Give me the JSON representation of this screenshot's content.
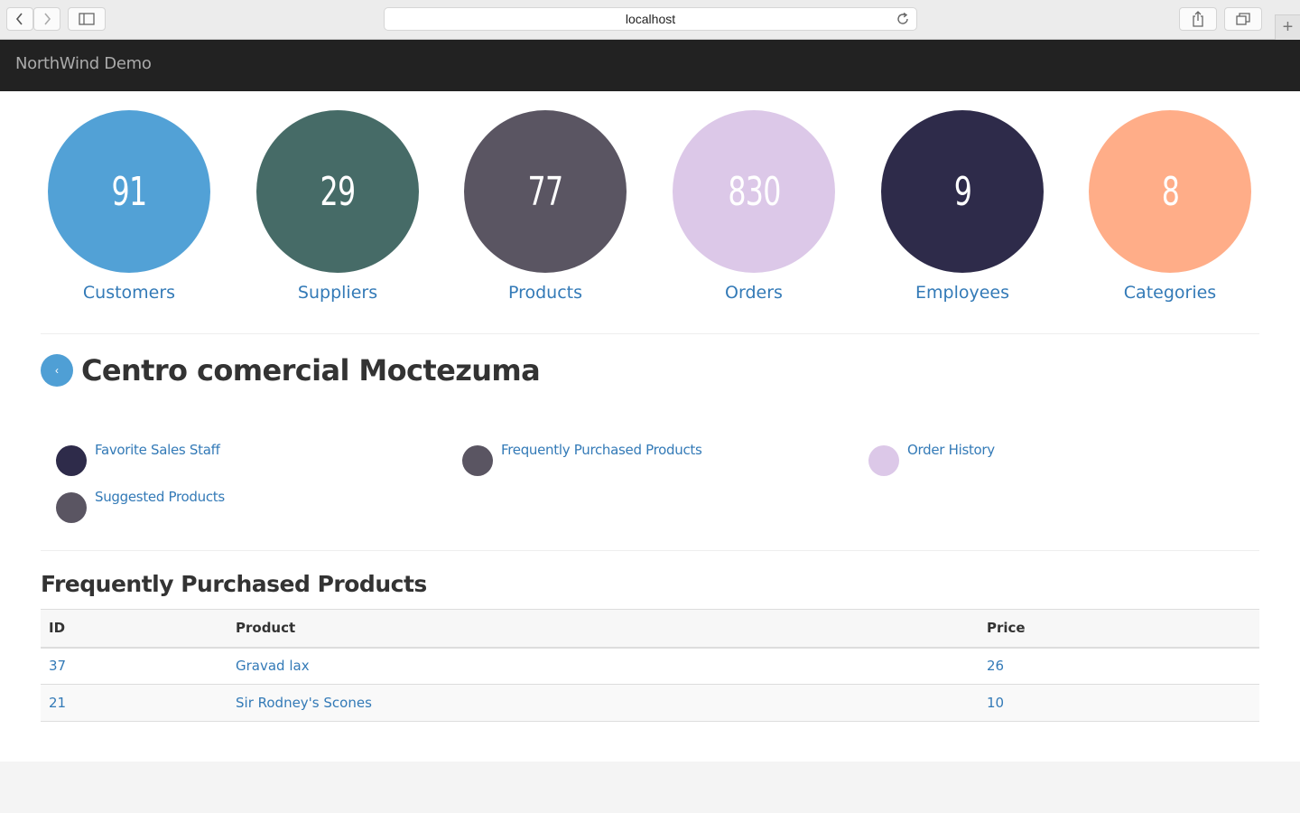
{
  "browser": {
    "address": "localhost",
    "new_tab_symbol": "+"
  },
  "navbar": {
    "brand": "NorthWind Demo"
  },
  "stats": [
    {
      "count": "91",
      "label": "Customers",
      "color": "#52a1d6"
    },
    {
      "count": "29",
      "label": "Suppliers",
      "color": "#466b67"
    },
    {
      "count": "77",
      "label": "Products",
      "color": "#5a5562"
    },
    {
      "count": "830",
      "label": "Orders",
      "color": "#dcc8e8"
    },
    {
      "count": "9",
      "label": "Employees",
      "color": "#2e2b4a"
    },
    {
      "count": "8",
      "label": "Categories",
      "color": "#ffad88"
    }
  ],
  "customer": {
    "back_icon": "chevron-left-icon",
    "back_symbol": "‹",
    "name": "Centro comercial Moctezuma"
  },
  "links": [
    {
      "label": "Favorite Sales Staff",
      "color": "#2e2b4a"
    },
    {
      "label": "Frequently Purchased Products",
      "color": "#5a5562"
    },
    {
      "label": "Order History",
      "color": "#dcc8e8"
    },
    {
      "label": "Suggested Products",
      "color": "#5a5562"
    }
  ],
  "section": {
    "title": "Frequently Purchased Products"
  },
  "table": {
    "headers": [
      "ID",
      "Product",
      "Price"
    ],
    "rows": [
      [
        "37",
        "Gravad lax",
        "26"
      ],
      [
        "21",
        "Sir Rodney's Scones",
        "10"
      ]
    ]
  }
}
